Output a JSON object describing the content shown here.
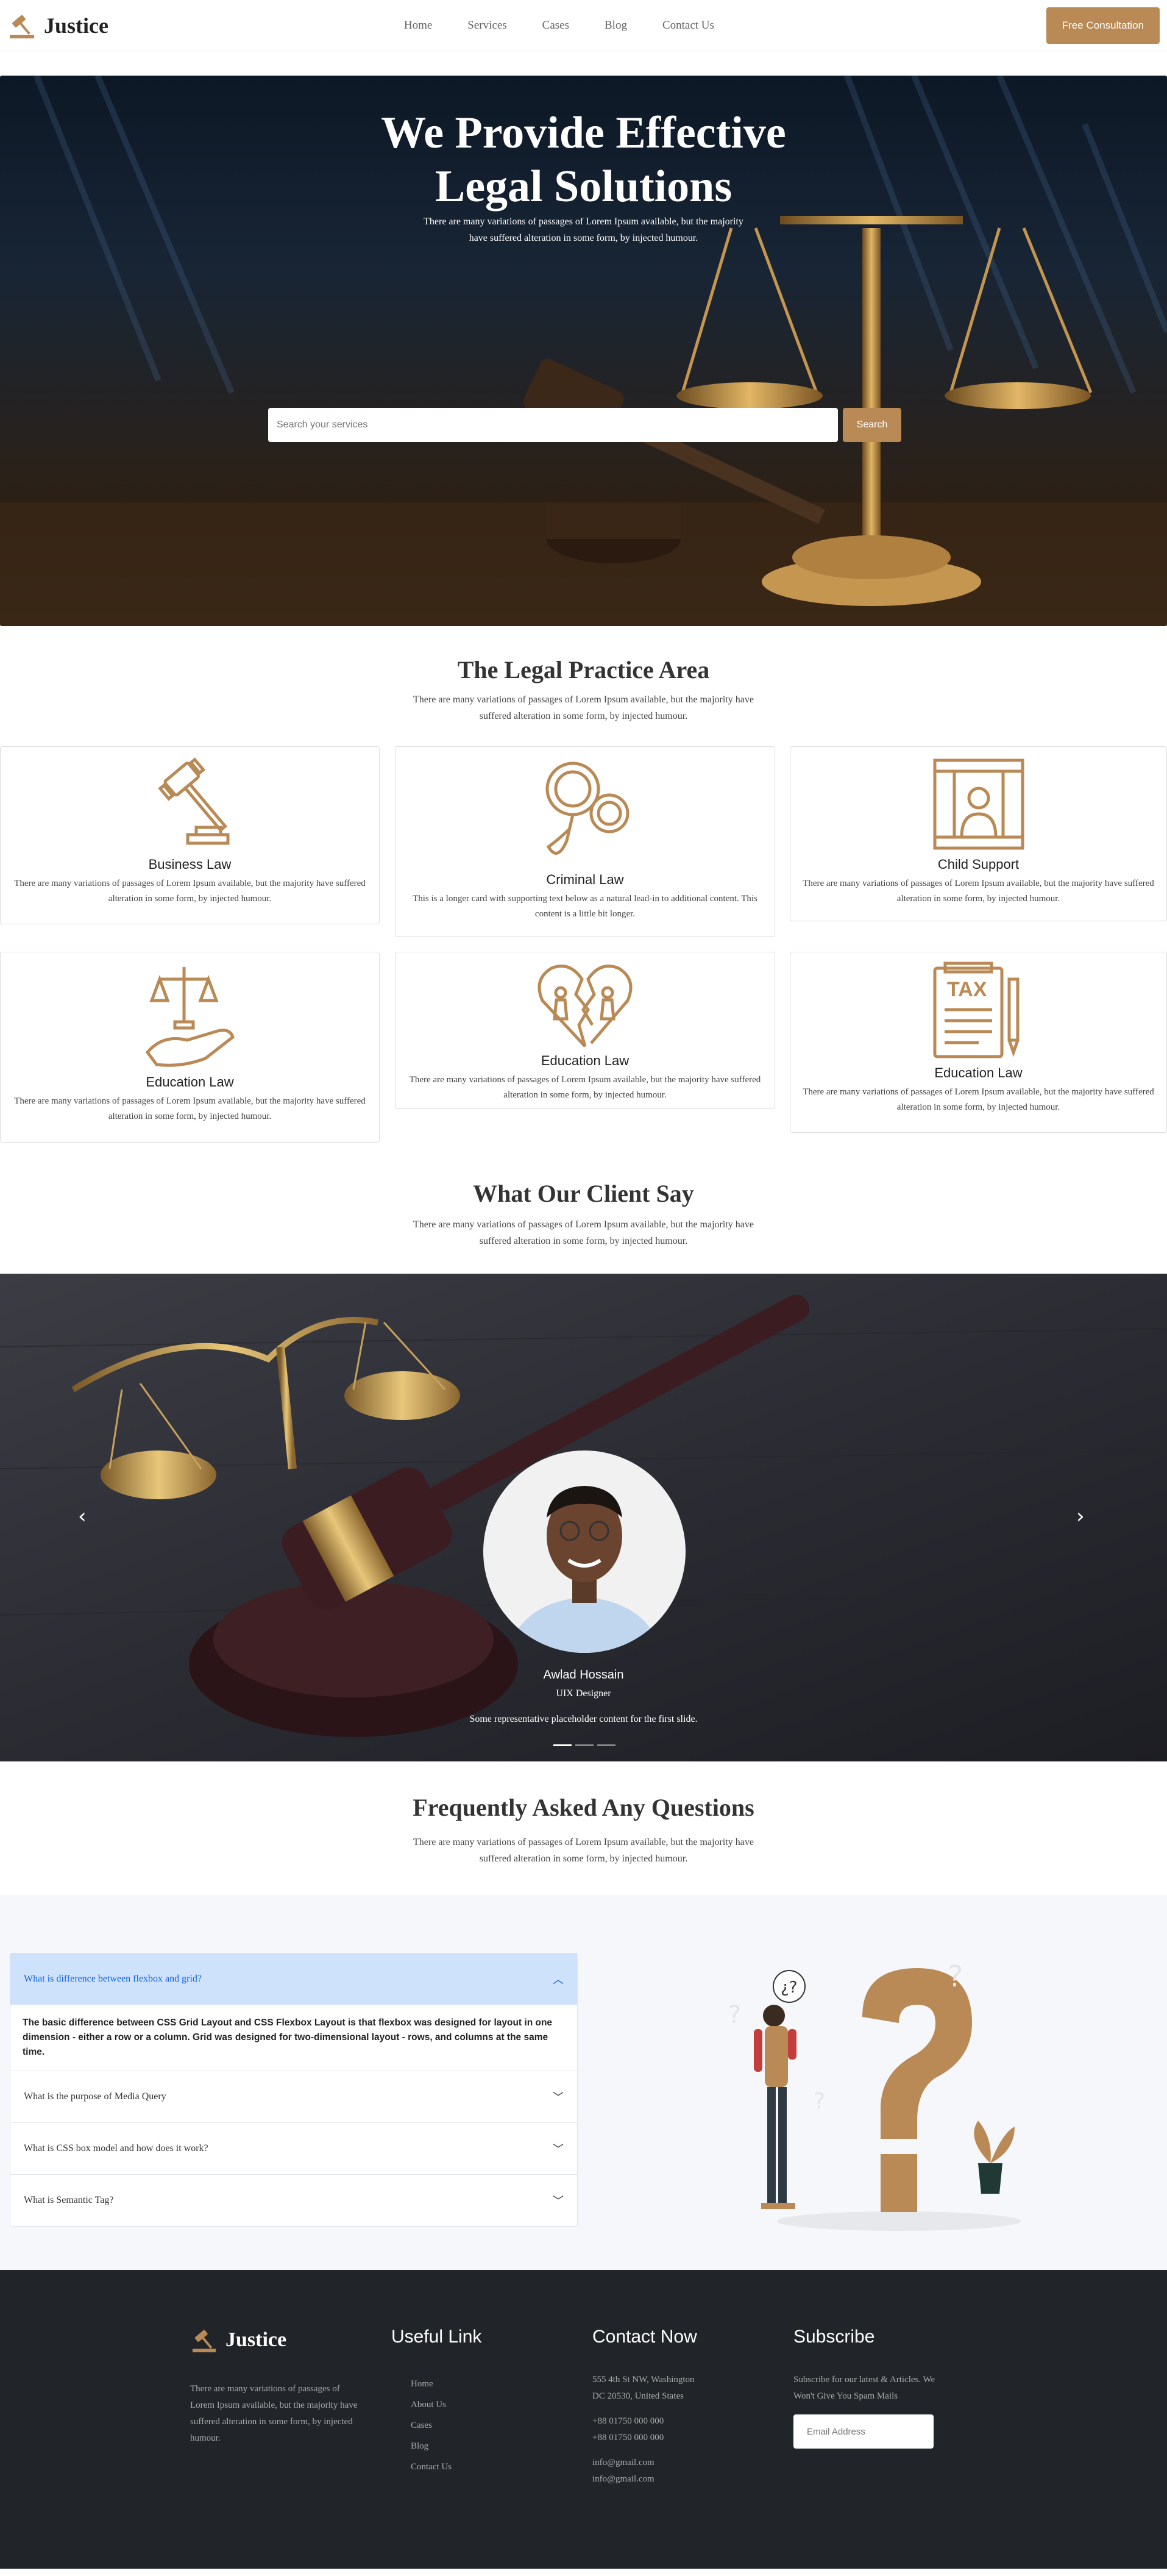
{
  "brand": {
    "name": "Justice"
  },
  "nav": {
    "items": [
      "Home",
      "Services",
      "Cases",
      "Blog",
      "Contact Us"
    ],
    "cta": "Free Consultation"
  },
  "hero": {
    "title_line1": "We Provide Effective",
    "title_line2": "Legal Solutions",
    "subtitle_line1": "There are many variations of passages of Lorem Ipsum available, but the majority",
    "subtitle_line2": "have suffered alteration in some form, by injected humour.",
    "search_placeholder": "Search your services",
    "search_button": "Search"
  },
  "practice": {
    "title": "The Legal Practice Area",
    "subtitle": "There are many variations of passages of Lorem Ipsum available, but the majority have suffered alteration in some form, by injected humour.",
    "cards": [
      {
        "title": "Business Law",
        "text": "There are many variations of passages of Lorem Ipsum available, but the majority have suffered alteration in some form, by injected humour.",
        "icon": "gavel-icon"
      },
      {
        "title": "Criminal Law",
        "text": "This is a longer card with supporting text below as a natural lead-in to additional content. This content is a little bit longer.",
        "icon": "handcuffs-icon"
      },
      {
        "title": "Child Support",
        "text": "There are many variations of passages of Lorem Ipsum available, but the majority have suffered alteration in some form, by injected humour.",
        "icon": "prison-icon"
      },
      {
        "title": "Education Law",
        "text": "There are many variations of passages of Lorem Ipsum available, but the majority have suffered alteration in some form, by injected humour.",
        "icon": "scales-hand-icon"
      },
      {
        "title": "Education Law",
        "text": "There are many variations of passages of Lorem Ipsum available, but the majority have suffered alteration in some form, by injected humour.",
        "icon": "broken-heart-icon"
      },
      {
        "title": "Education Law",
        "text": "There are many variations of passages of Lorem Ipsum available, but the majority have suffered alteration in some form, by injected humour.",
        "icon": "tax-document-icon"
      }
    ]
  },
  "testimonials": {
    "title": "What Our Client Say",
    "subtitle": "There are many variations of passages of Lorem Ipsum available, but the majority have suffered alteration in some form, by injected humour.",
    "name": "Awlad Hossain",
    "role": "UIX Designer",
    "quote": "Some representative placeholder content for the first slide.",
    "slides": 3,
    "active_slide": 1
  },
  "faq": {
    "title": "Frequently Asked Any Questions",
    "subtitle": "There are many variations of passages of Lorem Ipsum available, but the majority have suffered alteration in some form, by injected humour.",
    "items": [
      {
        "question": "What is difference between flexbox and grid?",
        "answer": "The basic difference between CSS Grid Layout and CSS Flexbox Layout is that flexbox was designed for layout in one dimension - either a row or a column. Grid was designed for two-dimensional layout - rows, and columns at the same time.",
        "open": true
      },
      {
        "question": "What is the purpose of Media Query",
        "open": false
      },
      {
        "question": "What is CSS box model and how does it work?",
        "open": false
      },
      {
        "question": "What is Semantic Tag?",
        "open": false
      }
    ]
  },
  "footer": {
    "about": "There are many variations of passages of Lorem Ipsum available, but the majority have suffered alteration in some form, by injected humour.",
    "links_title": "Useful Link",
    "links": [
      "Home",
      "About Us",
      "Cases",
      "Blog",
      "Contact Us"
    ],
    "contact_title": "Contact Now",
    "address_line1": "555 4th St NW, Washington",
    "address_line2": "DC 20530, United States",
    "phone1": "+88 01750 000 000",
    "phone2": "+88 01750 000 000",
    "email1": "info@gmail.com",
    "email2": "info@gmail.com",
    "subscribe_title": "Subscribe",
    "subscribe_text": "Subscribe for our latest & Articles. We Won't Give You Spam Mails",
    "email_placeholder": "Email Address"
  },
  "colors": {
    "accent": "#b98a55",
    "footer_bg": "#212529",
    "faq_open_bg": "#cfe2fc"
  }
}
